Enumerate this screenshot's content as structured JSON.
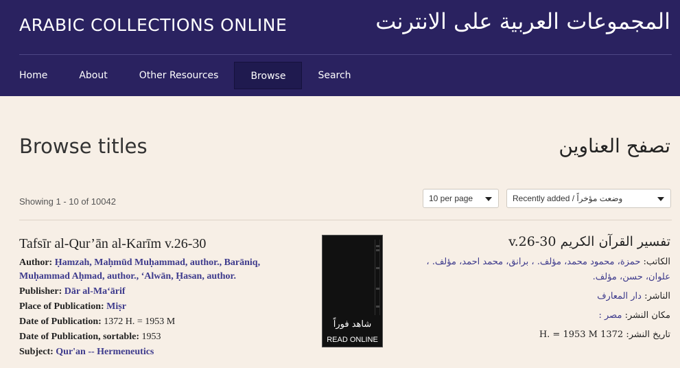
{
  "header": {
    "title_en": "ARABIC COLLECTIONS ONLINE",
    "title_ar": "المجموعات العربية على الانترنت"
  },
  "nav": {
    "items": [
      {
        "label": "Home"
      },
      {
        "label": "About"
      },
      {
        "label": "Other Resources"
      },
      {
        "label": "Browse",
        "active": true
      },
      {
        "label": "Search"
      }
    ]
  },
  "page": {
    "title_en": "Browse titles",
    "title_ar": "تصفح العناوين"
  },
  "toolbar": {
    "showing": "Showing 1 - 10 of 10042",
    "per_page": "10 per page",
    "sort": "Recently added / وضعت مؤخراً"
  },
  "record": {
    "title_en": "Tafsīr al-Qur’ān al-Karīm v.26-30",
    "author_label": "Author:",
    "author_value": "Ḥamzah, Maḥmūd Muḥammad, author., Barāniq, Muḥammad Aḥmad, author., ‘Alwān, Ḥasan, author.",
    "publisher_label": "Publisher:",
    "publisher_value": "Dār al-Ma‘ārif",
    "place_label": "Place of Publication:",
    "place_value": "Miṣr",
    "date_label": "Date of Publication:",
    "date_value": "1372 H. = 1953 M",
    "date_sort_label": "Date of Publication, sortable:",
    "date_sort_value": "1953",
    "subject_label": "Subject:",
    "subject_value": "Qur'an -- Hermeneutics",
    "thumb_ar": "شاهد فوراً",
    "thumb_en": "READ ONLINE",
    "title_ar": "تفسير القرآن الكريم v.26-30",
    "author_ar_label": "الكاتب:",
    "author_ar_value": "حمزة، محمود محمد، مؤلف. ، برانق، محمد احمد، مؤلف. ، علوان، حسن، مؤلف.",
    "publisher_ar_label": "الناشر:",
    "publisher_ar_value": "دار المعارف",
    "place_ar_label": "مكان النشر:",
    "place_ar_value": "مصر :",
    "date_ar_label": "تاريخ النشر:",
    "date_ar_value": "1372 H. = 1953 M"
  }
}
